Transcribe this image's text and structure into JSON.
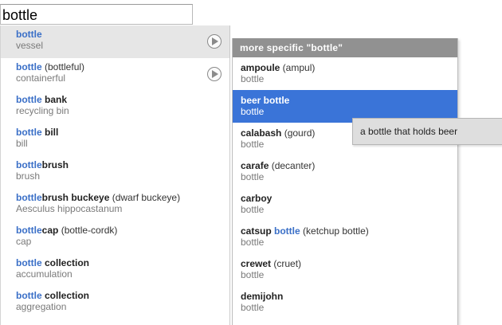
{
  "search": {
    "value": "bottle"
  },
  "primary_list": [
    {
      "hl": "bottle",
      "rest": "",
      "paren": "",
      "sub": "vessel",
      "expandable": true,
      "hover": true
    },
    {
      "hl": "bottle",
      "rest": "",
      "paren": " (bottleful)",
      "sub": "containerful",
      "expandable": true,
      "hover": false
    },
    {
      "hl": "bottle",
      "rest": " bank",
      "paren": "",
      "sub": "recycling bin",
      "expandable": false,
      "hover": false
    },
    {
      "hl": "bottle",
      "rest": " bill",
      "paren": "",
      "sub": "bill",
      "expandable": false,
      "hover": false
    },
    {
      "hl": "bottle",
      "rest": "brush",
      "paren": "",
      "sub": "brush",
      "expandable": false,
      "hover": false
    },
    {
      "hl": "bottle",
      "rest": "brush buckeye",
      "paren": " (dwarf buckeye)",
      "sub": "Aesculus hippocastanum",
      "expandable": false,
      "hover": false
    },
    {
      "hl": "bottle",
      "rest": "cap",
      "paren": " (bottle-cordk)",
      "sub": "cap",
      "expandable": false,
      "hover": false
    },
    {
      "hl": "bottle",
      "rest": " collection",
      "paren": "",
      "sub": "accumulation",
      "expandable": false,
      "hover": false
    },
    {
      "hl": "bottle",
      "rest": " collection",
      "paren": "",
      "sub": "aggregation",
      "expandable": false,
      "hover": false
    }
  ],
  "sub_panel": {
    "header": "more specific \"bottle\"",
    "items": [
      {
        "pre": "ampoule",
        "paren": " (ampul)",
        "hl": "",
        "post": "",
        "post_paren": "",
        "sub": "bottle",
        "selected": false
      },
      {
        "pre": "beer bottle",
        "paren": "",
        "hl": "",
        "post": "",
        "post_paren": "",
        "sub": "bottle",
        "selected": true
      },
      {
        "pre": "calabash",
        "paren": " (gourd)",
        "hl": "",
        "post": "",
        "post_paren": "",
        "sub": "bottle",
        "selected": false
      },
      {
        "pre": "carafe",
        "paren": " (decanter)",
        "hl": "",
        "post": "",
        "post_paren": "",
        "sub": "bottle",
        "selected": false
      },
      {
        "pre": "carboy",
        "paren": "",
        "hl": "",
        "post": "",
        "post_paren": "",
        "sub": "bottle",
        "selected": false
      },
      {
        "pre": "catsup ",
        "paren": "",
        "hl": "bottle",
        "post": "",
        "post_paren": " (ketchup bottle)",
        "sub": "bottle",
        "selected": false
      },
      {
        "pre": "crewet",
        "paren": " (cruet)",
        "hl": "",
        "post": "",
        "post_paren": "",
        "sub": "bottle",
        "selected": false
      },
      {
        "pre": "demijohn",
        "paren": "",
        "hl": "",
        "post": "",
        "post_paren": "",
        "sub": "bottle",
        "selected": false
      }
    ]
  },
  "tooltip": {
    "text": "a bottle that holds beer"
  },
  "colors": {
    "highlight": "#3a6fc7",
    "selected_bg": "#3a74d8",
    "header_bg": "#919191",
    "hover_bg": "#e6e6e6"
  },
  "icons": {
    "expand": "play-circle-icon"
  }
}
